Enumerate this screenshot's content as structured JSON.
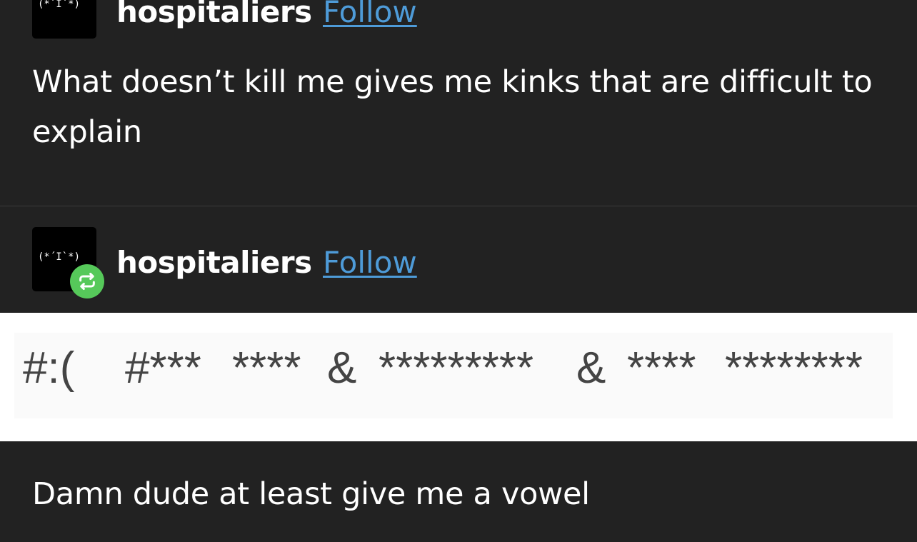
{
  "posts": [
    {
      "avatar_text": "(*´I`*)",
      "username": "hospitaliers",
      "follow_label": "Follow",
      "text": "What doesn’t kill me gives me kinks that are difficult to explain"
    },
    {
      "avatar_text": "(*´I`*)",
      "username": "hospitaliers",
      "follow_label": "Follow",
      "reblog_icon": "repeat-icon",
      "image_tokens": [
        "#:(",
        "#***",
        "****",
        "&",
        "*********",
        "&",
        "****",
        "********"
      ],
      "text": "Damn dude at least give me a vowel"
    }
  ],
  "colors": {
    "background": "#222222",
    "follow_link": "#4e9bd8",
    "reblog_badge": "#56c95a",
    "image_background": "#ffffff"
  }
}
